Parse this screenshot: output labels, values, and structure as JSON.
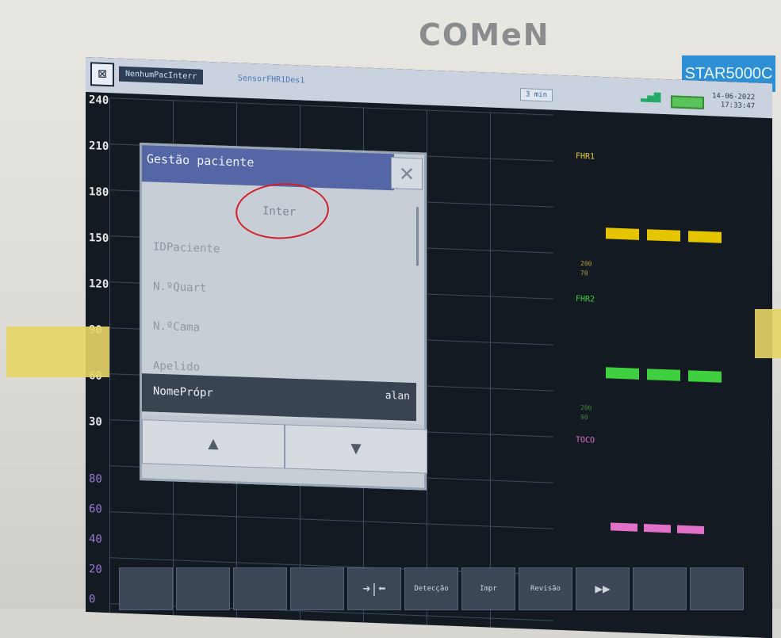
{
  "brand": "COMeN",
  "model": "STAR5000C",
  "topbar": {
    "patient_status": "NenhumPacInterr",
    "sensor_status": "SensorFHR1Des1",
    "speed": "3 min",
    "date": "14-06-2022",
    "time": "17:33:47"
  },
  "yaxis_fhr": [
    "240",
    "210",
    "180",
    "150",
    "120",
    "90",
    "60",
    "30"
  ],
  "yaxis_toco": [
    "80",
    "60",
    "40",
    "20",
    "0"
  ],
  "right_panel": {
    "fhr1_label": "FHR1",
    "fhr2_label": "FHR2",
    "toco_label": "TOCO",
    "fhr1_limits": [
      "200",
      "70"
    ],
    "fhr2_limits": [
      "200",
      "90"
    ],
    "fhr1_color": "#e5c400",
    "fhr2_color": "#3fcf3f",
    "toco_color": "#e070c8"
  },
  "dialog": {
    "title": "Gestão paciente",
    "rows": [
      {
        "label": "Inter",
        "value": ""
      },
      {
        "label": "IDPaciente",
        "value": ""
      },
      {
        "label": "N.ºQuart",
        "value": ""
      },
      {
        "label": "N.ºCama",
        "value": ""
      },
      {
        "label": "Apelido",
        "value": ""
      },
      {
        "label": "NomePrópr",
        "value": "alan"
      }
    ],
    "prev_icon": "▲",
    "next_icon": "▼"
  },
  "toolbar": {
    "buttons": [
      "",
      "",
      "",
      "",
      "➜|⬅",
      "Detecção",
      "Impr",
      "Revisão",
      "▶▶",
      "",
      ""
    ]
  }
}
